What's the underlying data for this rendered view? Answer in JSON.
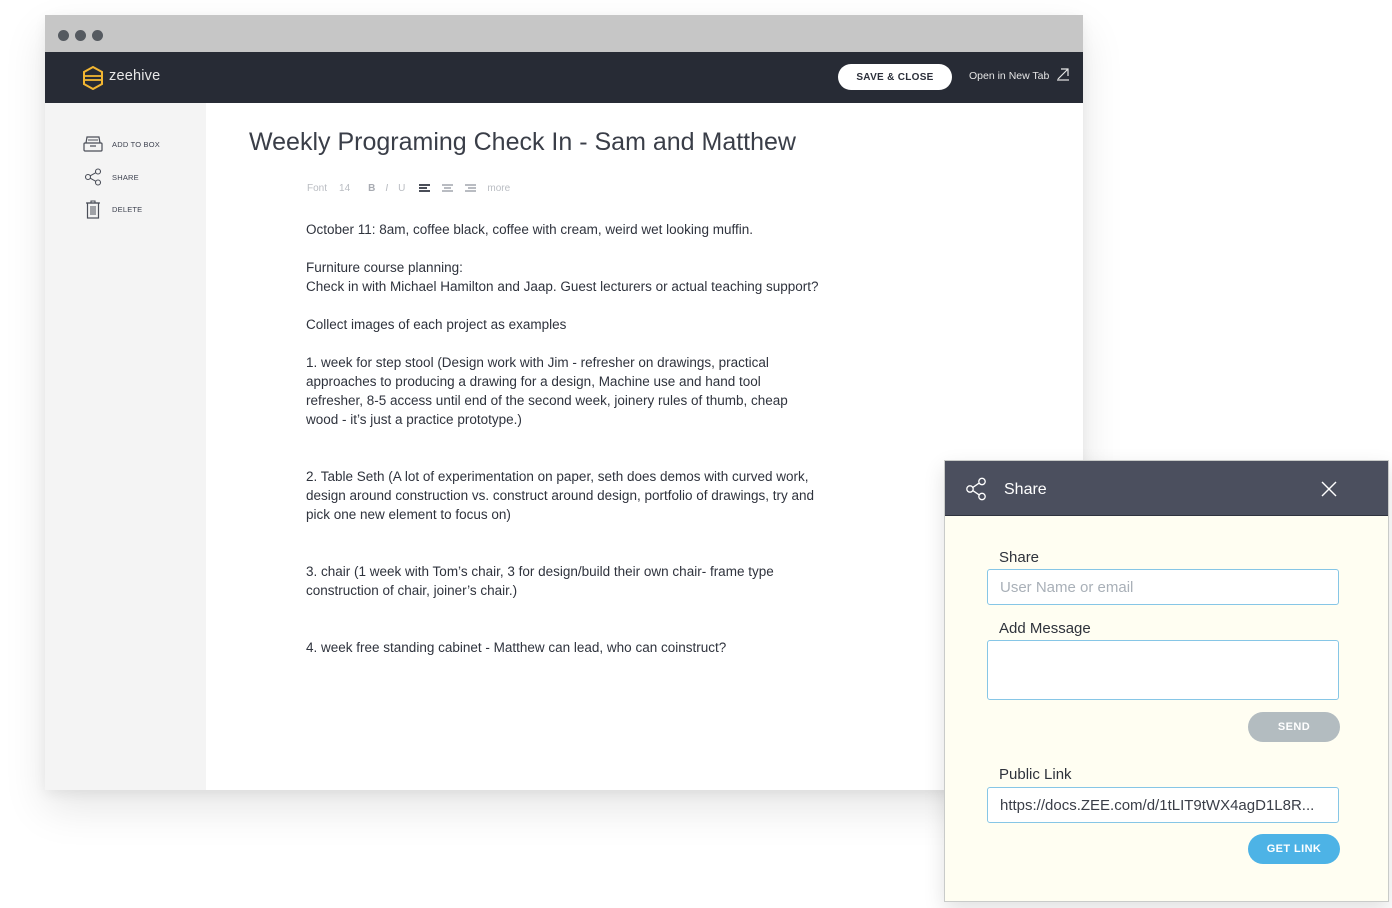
{
  "app": {
    "brand": "zeehive",
    "save_close": "SAVE & CLOSE",
    "open_new_tab": "Open in New Tab"
  },
  "sidebar": {
    "items": [
      {
        "label": "ADD TO BOX",
        "icon": "box-icon"
      },
      {
        "label": "SHARE",
        "icon": "share-icon"
      },
      {
        "label": "DELETE",
        "icon": "trash-icon"
      }
    ]
  },
  "document": {
    "title": "Weekly Programing Check In - Sam and Matthew",
    "toolbar": {
      "font": "Font",
      "size": "14",
      "bold": "B",
      "italic": "I",
      "underline": "U",
      "more": "more"
    },
    "paragraphs": [
      "October 11: 8am, coffee black, coffee with cream, weird wet looking muffin.",
      "Furniture course planning:",
      "Check in with Michael Hamilton and Jaap. Guest lecturers or actual teaching support?",
      "Collect images of each project as examples",
      "1. week for step stool (Design work with Jim - refresher on drawings, practical approaches to producing a drawing for a design, Machine use and hand tool refresher, 8-5 access until end of the second week, joinery rules of thumb, cheap wood - it’s just a practice prototype.)",
      "2. Table Seth (A lot of experimentation on paper, seth does demos with curved work, design around construction vs. construct around design, portfolio of drawings, try and pick one new element to focus on)",
      "3. chair (1 week with Tom’s chair, 3 for design/build their own chair- frame type construction of chair, joiner’s chair.)",
      "4. week free standing cabinet - Matthew can lead, who can coinstruct?"
    ]
  },
  "share_dialog": {
    "title": "Share",
    "share_label": "Share",
    "share_placeholder": "User Name or email",
    "message_label": "Add Message",
    "message_value": "",
    "send": "SEND",
    "public_link_label": "Public Link",
    "public_link_value": "https://docs.ZEE.com/d/1tLIT9tWX4agD1L8R...",
    "get_link": "GET LINK"
  },
  "colors": {
    "appbar": "#272b35",
    "brand_accent": "#f2b632",
    "dialog_header": "#4b4f5e",
    "dialog_bg": "#fffef2",
    "send_button": "#b3bcc0",
    "get_link_button": "#4db3e6",
    "field_border": "#86c6e6"
  }
}
